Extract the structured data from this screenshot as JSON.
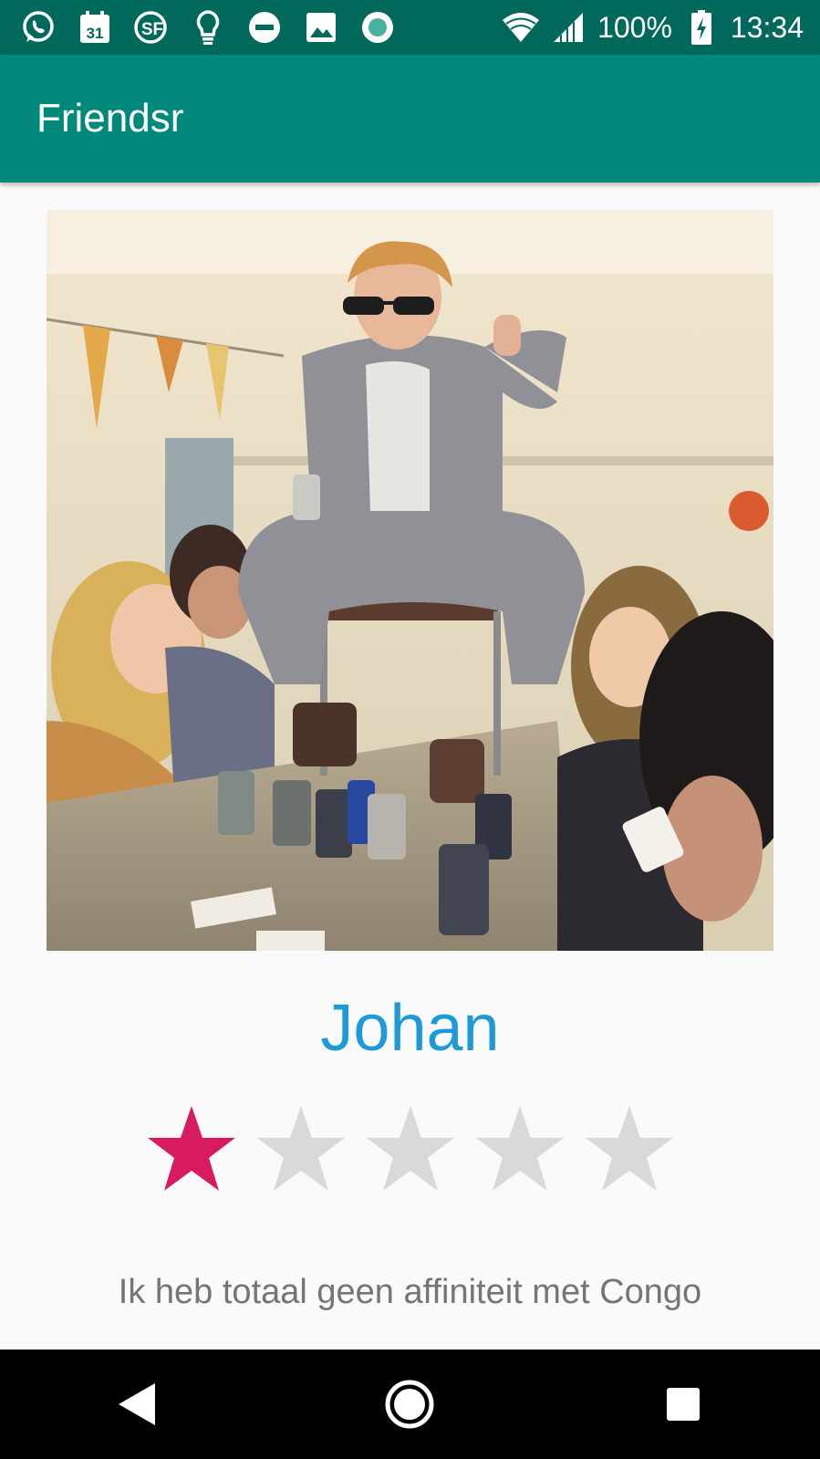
{
  "status_bar": {
    "battery": "100%",
    "time": "13:34",
    "notification_icons": [
      "whatsapp-icon",
      "calendar-icon",
      "sf-icon",
      "lightbulb-icon",
      "do-not-disturb-icon",
      "image-icon",
      "record-icon"
    ],
    "calendar_day": "31",
    "sf_label": "SF"
  },
  "app_bar": {
    "title": "Friendsr"
  },
  "profile": {
    "photo": "party-photo",
    "name": "Johan",
    "rating": 1,
    "rating_max": 5,
    "bio": "Ik heb totaal geen affiniteit met Congo"
  },
  "colors": {
    "status_bar": "#00695c",
    "app_bar": "#00897b",
    "name": "#1e9bd7",
    "star_filled": "#d81b60",
    "star_empty": "#d9d9d9",
    "bio": "#757575"
  },
  "nav": [
    "back-icon",
    "home-icon",
    "recents-icon"
  ]
}
